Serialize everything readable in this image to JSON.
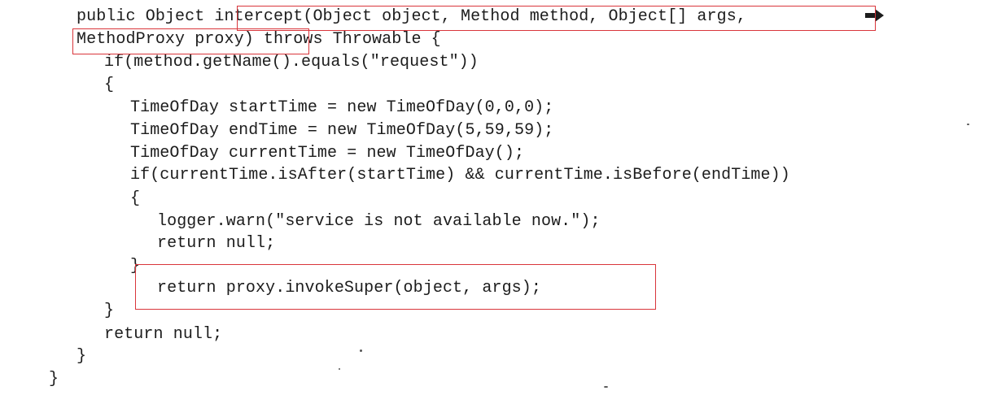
{
  "code": {
    "line_1": "public Object intercept(Object object, Method method, Object[] args,",
    "line_2": "MethodProxy proxy) throws Throwable {",
    "line_3": "if(method.getName().equals(\"request\"))",
    "line_4": "{",
    "line_5": "TimeOfDay startTime = new TimeOfDay(0,0,0);",
    "line_6": "TimeOfDay endTime = new TimeOfDay(5,59,59);",
    "line_7": "TimeOfDay currentTime = new TimeOfDay();",
    "line_8": "if(currentTime.isAfter(startTime) && currentTime.isBefore(endTime))",
    "line_9": "{",
    "line_10": "logger.warn(\"service is not available now.\");",
    "line_11": "return null;",
    "line_12": "}",
    "line_13": "return proxy.invokeSuper(object, args);",
    "line_14": "}",
    "line_15": "return null;",
    "line_16": "}",
    "line_17": "}"
  },
  "icons": {
    "continuation": "line-continuation-arrow-icon"
  },
  "colors": {
    "text": "#1c1c1c",
    "highlight_border": "#d9363b",
    "background": "#ffffff"
  }
}
